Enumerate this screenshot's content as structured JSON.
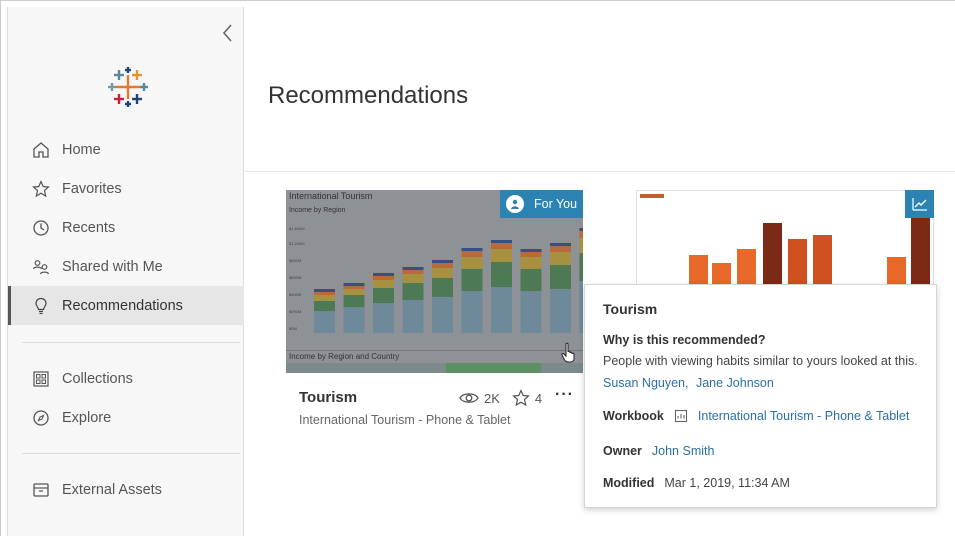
{
  "sidebar": {
    "collapse_icon": "chevron-left-icon",
    "logo": "tableau-logo",
    "items": [
      {
        "label": "Home",
        "icon": "home-icon"
      },
      {
        "label": "Favorites",
        "icon": "star-icon"
      },
      {
        "label": "Recents",
        "icon": "clock-icon"
      },
      {
        "label": "Shared with Me",
        "icon": "shared-users-icon"
      },
      {
        "label": "Recommendations",
        "icon": "lightbulb-icon",
        "active": true
      },
      {
        "label": "Collections",
        "icon": "collections-icon"
      },
      {
        "label": "Explore",
        "icon": "compass-icon"
      },
      {
        "label": "External Assets",
        "icon": "archive-box-icon"
      }
    ]
  },
  "main": {
    "title": "Recommendations"
  },
  "card": {
    "badge": "For You",
    "title": "Tourism",
    "subtitle": "International Tourism - Phone & Tablet",
    "views": "2K",
    "favorites": "4",
    "more": "···",
    "thumb_title": "International Tourism",
    "thumb_subtitle": "Income by Region",
    "thumb_footer": "Income by Region and Country"
  },
  "popover": {
    "title": "Tourism",
    "why_heading": "Why is this recommended?",
    "description": "People with viewing habits similar to yours looked at this.",
    "user1": "Susan Nguyen,",
    "user2": "Jane Johnson",
    "workbook_label": "Workbook",
    "workbook_value": "International Tourism - Phone & Tablet",
    "owner_label": "Owner",
    "owner_value": "John Smith",
    "modified_label": "Modified",
    "modified_value": "Mar 1, 2019, 11:34 AM"
  },
  "colors": {
    "accent": "#2c83b1",
    "link": "#2c6fa8",
    "sidebar_bg": "#f7f7f7",
    "active_bg": "#e6e6e6"
  }
}
